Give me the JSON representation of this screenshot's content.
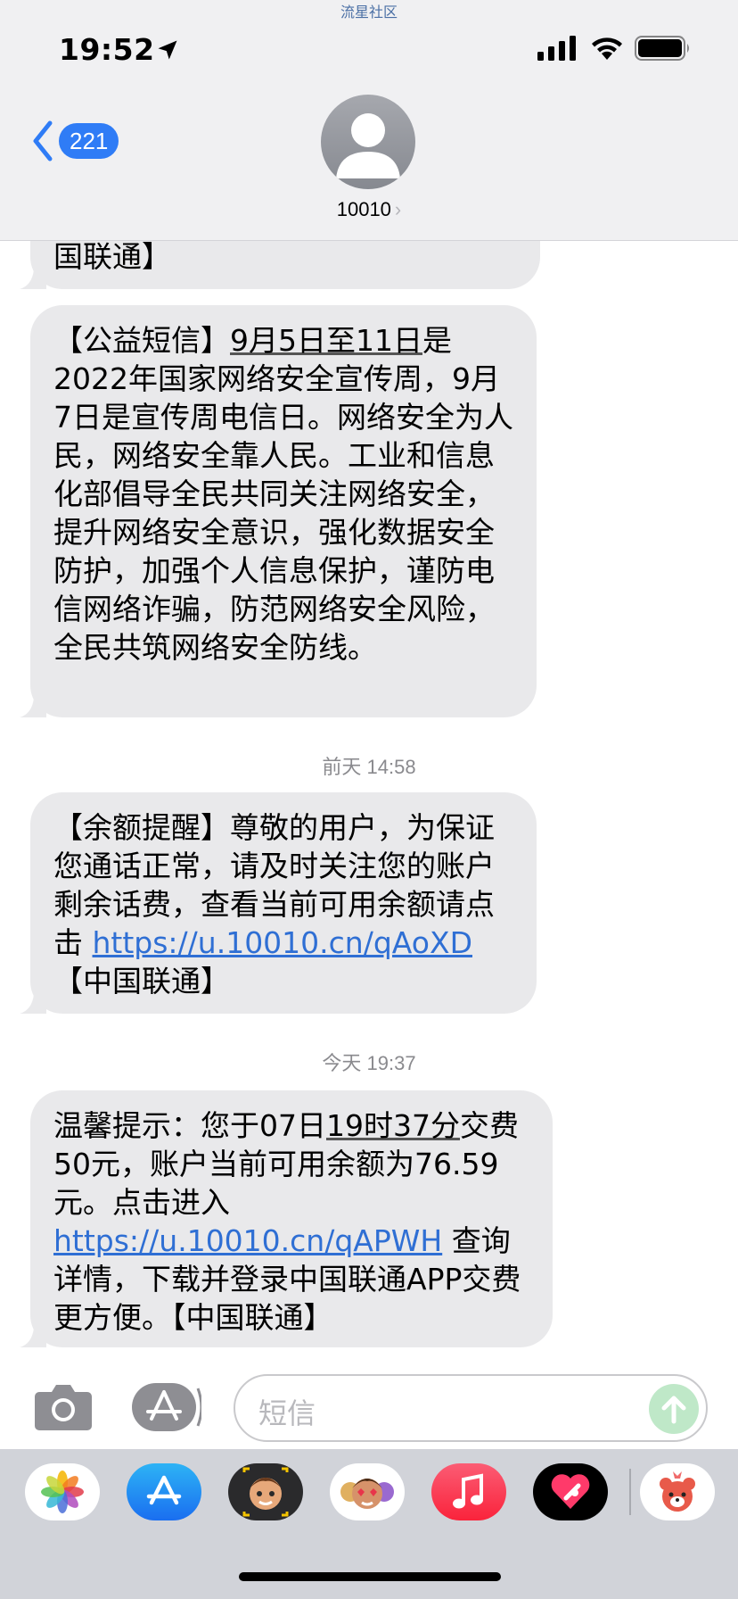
{
  "watermark": "流星社区",
  "status_bar": {
    "time": "19:52"
  },
  "nav": {
    "back_count": "221",
    "contact": "10010",
    "contact_chevron": "›"
  },
  "messages": [
    {
      "text": "国联通】"
    },
    {
      "text_prefix": "【公益短信】",
      "date_text": "9月5日至11日",
      "text_rest": "是2022年国家网络安全宣传周，9月7日是宣传周电信日。网络安全为人民，网络安全靠人民。工业和信息化部倡导全民共同关注网络安全，提升网络安全意识，强化数据安全防护，加强个人信息保护，谨防电信网络诈骗，防范网络安全风险，全民共筑网络安全防线。"
    },
    {
      "timestamp": "前天 14:58"
    },
    {
      "text": "【余额提醒】尊敬的用户，为保证您通话正常，请及时关注您的账户剩余话费，查看当前可用余额请点击 ",
      "link": "https://u.10010.cn/qAoXD",
      "suffix": " 【中国联通】"
    },
    {
      "timestamp": "今天 19:37"
    },
    {
      "text_prefix": "温馨提示：您于07日",
      "time_text": "19时37分",
      "text_mid": "交费50元，账户当前可用余额为76.59元。点击进入 ",
      "link": "https://u.10010.cn/qAPWH",
      "suffix": " 查询详情，下载并登录中国联通APP交费更方便。【中国联通】"
    }
  ],
  "input": {
    "placeholder": "短信"
  },
  "tray_apps": [
    "photos-icon",
    "app-store-icon",
    "memoji-icon",
    "animoji-icon",
    "music-icon",
    "digital-touch-icon",
    "bear-sticker-icon"
  ],
  "colors": {
    "accent": "#2f7cf6",
    "bubble": "#e9e9eb",
    "link": "#2f6fd4"
  }
}
